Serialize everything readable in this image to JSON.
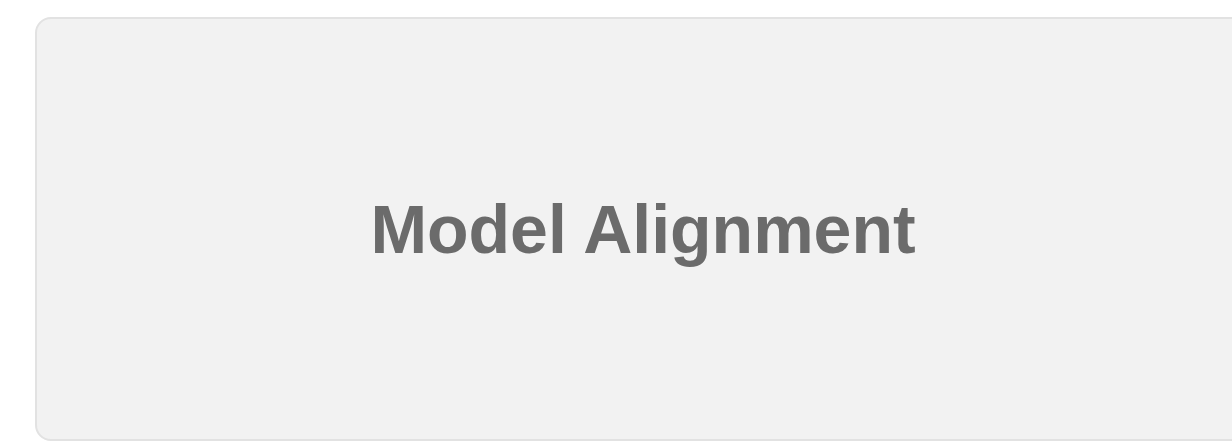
{
  "card": {
    "title": "Model Alignment"
  }
}
